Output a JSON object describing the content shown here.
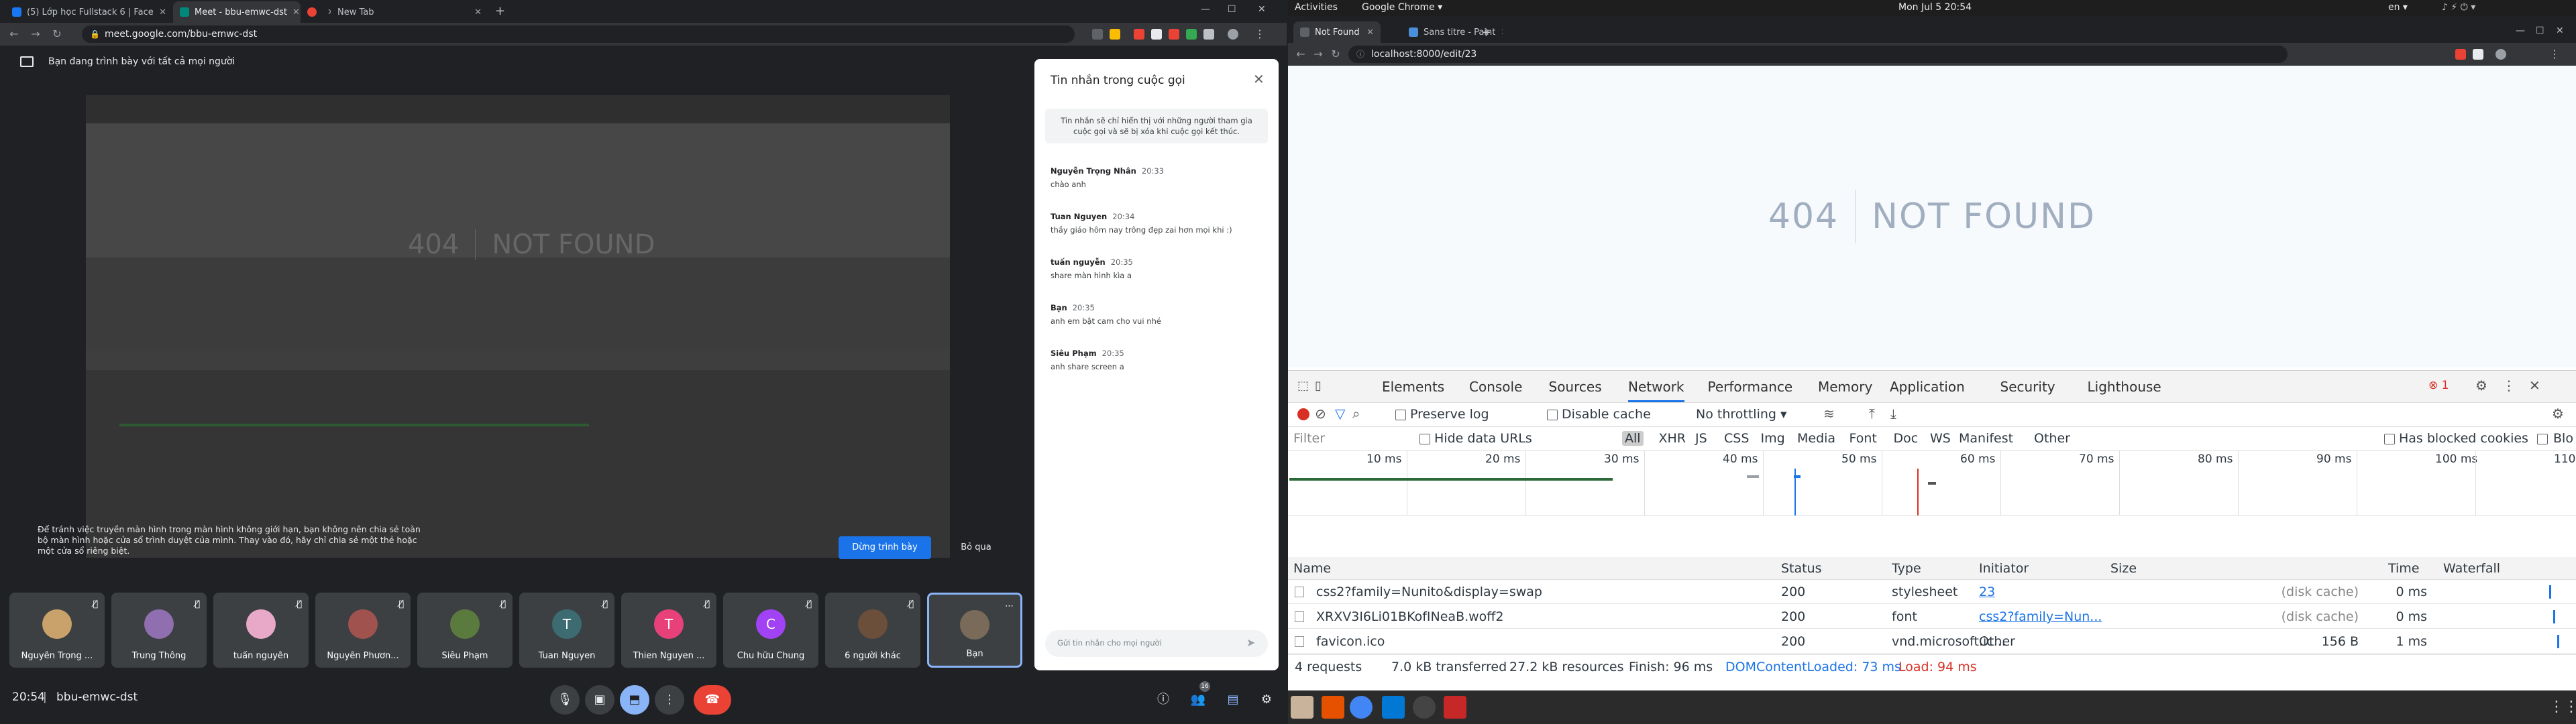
{
  "left_browser": {
    "tabs": [
      {
        "title": "(5) Lớp học Fullstack 6 | Face"
      },
      {
        "title": "Meet - bbu-emwc-dst"
      },
      {
        "title": ""
      },
      {
        "title": "New Tab"
      }
    ],
    "url": "meet.google.com/bbu-emwc-dst",
    "presenting_text": "Bạn đang trình bày với tất cả mọi người",
    "shared_404": "404",
    "shared_notfound": "NOT FOUND",
    "warning": "Để tránh việc truyền màn hình trong màn hình không giới hạn, bạn không nên chia sẻ toàn bộ màn hình hoặc cửa sổ trình duyệt của mình. Thay vào đó, hãy chỉ chia sẻ một thẻ hoặc một cửa sổ riêng biệt.",
    "stop_button": "Dừng trình bày",
    "skip_button": "Bỏ qua",
    "chat": {
      "title": "Tin nhắn trong cuộc gọi",
      "notice": "Tin nhắn sẽ chỉ hiển thị với những người tham gia cuộc gọi và sẽ bị xóa khi cuộc gọi kết thúc.",
      "messages": [
        {
          "sender": "Nguyễn Trọng Nhân",
          "time": "20:33",
          "text": "chào anh"
        },
        {
          "sender": "Tuan Nguyen",
          "time": "20:34",
          "text": "thầy giáo hôm nay trông đẹp zai hơn mọi khi :)"
        },
        {
          "sender": "tuấn nguyễn",
          "time": "20:35",
          "text": "share màn hình kìa a"
        },
        {
          "sender": "Bạn",
          "time": "20:35",
          "text": "anh em bật cam cho vui nhé"
        },
        {
          "sender": "Siêu Phạm",
          "time": "20:35",
          "text": "anh share screen a"
        }
      ],
      "input_placeholder": "Gửi tin nhắn cho mọi người"
    },
    "participants": [
      {
        "name": "Nguyễn Trọng ...",
        "initial": "",
        "color": "#c9a26b"
      },
      {
        "name": "Trung Thông",
        "initial": "",
        "color": "#8f6fb0"
      },
      {
        "name": "tuấn nguyễn",
        "initial": "",
        "color": "#e7a9c7"
      },
      {
        "name": "Nguyễn Phươn...",
        "initial": "",
        "color": "#a0524f"
      },
      {
        "name": "Siêu Phạm",
        "initial": "",
        "color": "#5b7a3d"
      },
      {
        "name": "Tuan Nguyen",
        "initial": "T",
        "color": "#3d6b72"
      },
      {
        "name": "Thien Nguyen ...",
        "initial": "T",
        "color": "#e8417a"
      },
      {
        "name": "Chu hữu Chung",
        "initial": "C",
        "color": "#a142f4"
      },
      {
        "name": "6 người khác",
        "initial": "",
        "color": "#6b4f3b"
      },
      {
        "name": "Bạn",
        "initial": "",
        "color": "#7a6a5a"
      }
    ],
    "time": "20:54",
    "meeting_code": "bbu-emwc-dst",
    "people_count": "16"
  },
  "right": {
    "gnome": {
      "activities": "Activities",
      "app": "Google Chrome ▾",
      "clock": "Mon Jul 5 20:54",
      "lang": "en ▾"
    },
    "tabs": [
      {
        "title": "Not Found"
      },
      {
        "title": "Sans titre - Paint"
      }
    ],
    "url": "localhost:8000/edit/23",
    "code": "404",
    "message": "NOT FOUND",
    "devtools": {
      "tabs": [
        "Elements",
        "Console",
        "Sources",
        "Network",
        "Performance",
        "Memory",
        "Application",
        "Security",
        "Lighthouse"
      ],
      "error_count": "1",
      "preserve_log": "Preserve log",
      "disable_cache": "Disable cache",
      "throttle": "No throttling",
      "filter_placeholder": "Filter",
      "hide_data_urls": "Hide data URLs",
      "types": [
        "All",
        "XHR",
        "JS",
        "CSS",
        "Img",
        "Media",
        "Font",
        "Doc",
        "WS",
        "Manifest",
        "Other"
      ],
      "blocked_cookies": "Has blocked cookies",
      "blocked_requests": "Blocked Requests",
      "ticks": [
        "10 ms",
        "20 ms",
        "30 ms",
        "40 ms",
        "50 ms",
        "60 ms",
        "70 ms",
        "80 ms",
        "90 ms",
        "100 ms",
        "110"
      ],
      "columns": [
        "Name",
        "Status",
        "Type",
        "Initiator",
        "Size",
        "Time",
        "Waterfall"
      ],
      "rows": [
        {
          "name": "css2?family=Nunito&display=swap",
          "status": "200",
          "type": "stylesheet",
          "initiator": "23",
          "size": "(disk cache)",
          "time": "0 ms"
        },
        {
          "name": "XRXV3I6Li01BKofINeaB.woff2",
          "status": "200",
          "type": "font",
          "initiator": "css2?family=Nun...",
          "size": "(disk cache)",
          "time": "0 ms"
        },
        {
          "name": "favicon.ico",
          "status": "200",
          "type": "vnd.microsoft.ic...",
          "initiator": "Other",
          "size": "156 B",
          "time": "1 ms"
        }
      ],
      "summary": {
        "requests": "4 requests",
        "transferred": "7.0 kB transferred",
        "resources": "27.2 kB resources",
        "finish": "Finish: 96 ms",
        "dcl": "DOMContentLoaded: 73 ms",
        "load": "Load: 94 ms"
      }
    }
  }
}
